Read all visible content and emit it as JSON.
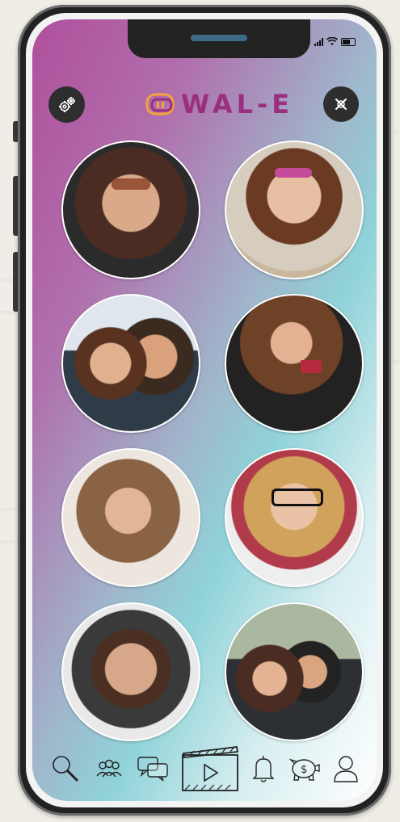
{
  "app": {
    "logo_text": "WAL-E",
    "accent_color": "#9b2f7f",
    "screen_gradient": [
      "#b04f9c",
      "#8fd3d9",
      "#ffffff"
    ]
  },
  "status_bar": {
    "icons": [
      "signal-icon",
      "wifi-icon",
      "battery-icon"
    ]
  },
  "header": {
    "left_button_icon": "gears-icon",
    "right_button_icon": "close-icon"
  },
  "profiles": [
    {
      "id": "profile-1",
      "description_icon": "avatar-photo"
    },
    {
      "id": "profile-2",
      "description_icon": "avatar-photo"
    },
    {
      "id": "profile-3",
      "description_icon": "avatar-photo"
    },
    {
      "id": "profile-4",
      "description_icon": "avatar-photo"
    },
    {
      "id": "profile-5",
      "description_icon": "avatar-photo"
    },
    {
      "id": "profile-6",
      "description_icon": "avatar-photo"
    },
    {
      "id": "profile-7",
      "description_icon": "avatar-photo"
    },
    {
      "id": "profile-8",
      "description_icon": "avatar-photo"
    }
  ],
  "bottom_nav": {
    "items": [
      "search-icon",
      "group-icon",
      "chat-icon",
      "video-play-icon",
      "bell-icon",
      "piggy-bank-icon",
      "user-icon"
    ],
    "active": "video-play-icon"
  }
}
